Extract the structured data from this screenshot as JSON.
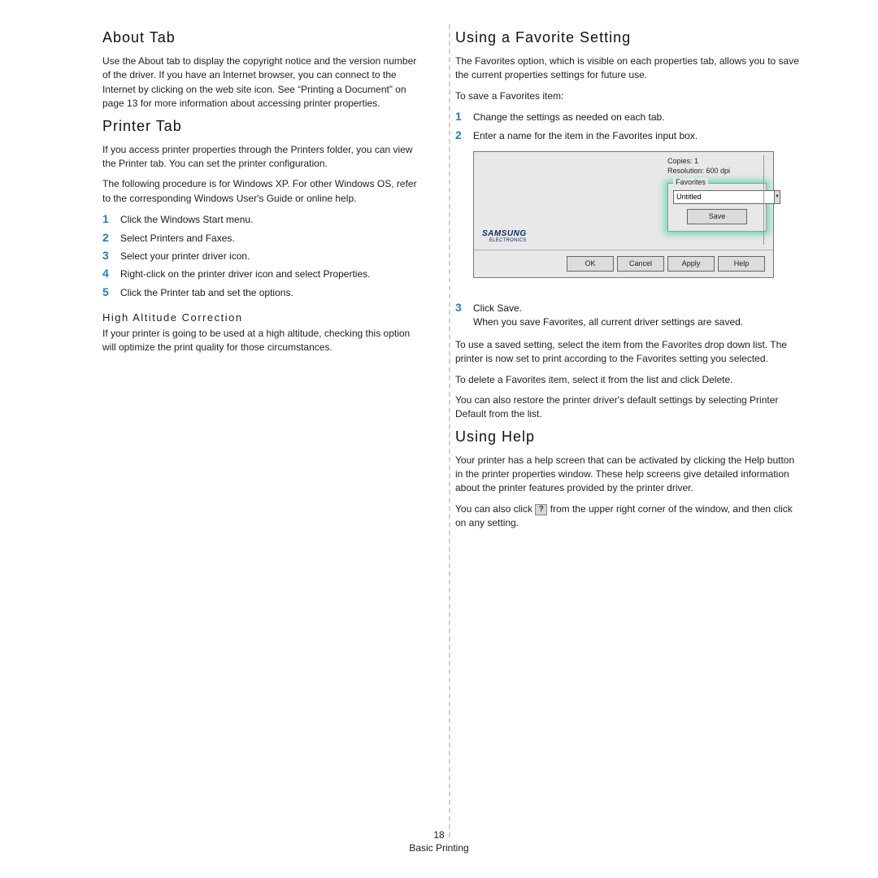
{
  "left": {
    "about": {
      "title": "About Tab",
      "p1": "Use the About tab to display the copyright notice and the version number of the driver. If you have an Internet browser, you can connect to the Internet by clicking on the web site icon. See “Printing a Document” on page 13 for more information about accessing printer properties."
    },
    "printer": {
      "title": "Printer Tab",
      "p1": "If you access printer properties through the Printers folder, you can view the Printer tab. You can set the printer configuration.",
      "p2": "The following procedure is for Windows XP. For other Windows OS, refer to the corresponding Windows User's Guide or online help.",
      "steps": [
        "Click the Windows Start menu.",
        "Select Printers and Faxes.",
        "Select your printer driver icon.",
        "Right-click on the printer driver icon and select Properties.",
        "Click the Printer tab and set the options."
      ],
      "sub_title": "High Altitude Correction",
      "sub_body": "If your printer is going to be used at a high altitude, checking this option will optimize the print quality for those circumstances."
    }
  },
  "right": {
    "fav": {
      "title": "Using a Favorite Setting",
      "p1": "The Favorites option, which is visible on each properties tab, allows you to save the current properties settings for future use.",
      "p2": "To save a Favorites item:",
      "steps12": [
        "Change the settings as needed on each tab.",
        "Enter a name for the item in the Favorites input box."
      ],
      "step3": "Click Save.",
      "step3b": "When you save Favorites, all current driver settings are saved.",
      "p3": "To use a saved setting, select the item from the Favorites drop down list. The printer is now set to print according to the Favorites setting you selected.",
      "p4": "To delete a Favorites item, select it from the list and click Delete.",
      "p5": "You can also restore the printer driver's default settings by selecting Printer Default from the list."
    },
    "help": {
      "title": "Using Help",
      "p1": "Your printer has a help screen that can be activated by clicking the Help button in the printer properties window. These help screens give detailed information about the printer features provided by the printer driver.",
      "p2a": "You can also click ",
      "p2b": " from the upper right corner of the window, and then click on any setting."
    },
    "shot": {
      "copies_label": "Copies:",
      "copies_value": "1",
      "resolution_line": "Resolution: 600 dpi",
      "fav_legend": "Favorites",
      "fav_value": "Untitled",
      "save": "Save",
      "brand": "SAMSUNG",
      "brand_sub": "ELECTRONICS",
      "ok": "OK",
      "cancel": "Cancel",
      "apply": "Apply",
      "help": "Help"
    }
  },
  "footer": {
    "page": "18",
    "chapter": "Basic Printing"
  },
  "icons": {
    "question": "?"
  }
}
